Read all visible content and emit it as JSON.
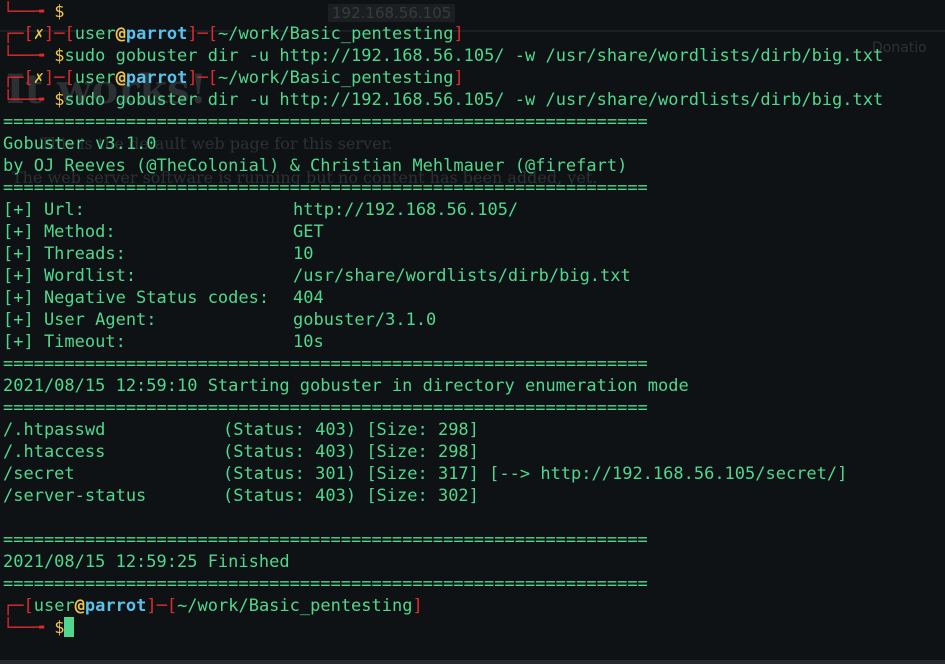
{
  "prompt": {
    "user": "user",
    "at": "@",
    "host": "parrot",
    "path": "~/work/Basic_pentesting",
    "error_mark": "✗",
    "dollar": "$"
  },
  "background_browser": {
    "url": "192.168.56.105",
    "donate": "Donatio",
    "heading": "It works!",
    "line1": "This is the default web page for this server.",
    "line2": "The web server software is running but no content has been added, yet."
  },
  "commands": {
    "first": "sudo gobuster dir -u http://192.168.56.105/ -w /usr/share/wordlists/dirb/big.txt",
    "second": "sudo gobuster dir -u http://192.168.56.105/ -w /usr/share/wordlists/dirb/big.txt"
  },
  "separator": "===============================================================",
  "banner": {
    "title": "Gobuster v3.1.0",
    "authors": "by OJ Reeves (@TheColonial) & Christian Mehlmauer (@firefart)"
  },
  "config": [
    {
      "key": "[+] Url:",
      "value": "http://192.168.56.105/"
    },
    {
      "key": "[+] Method:",
      "value": "GET"
    },
    {
      "key": "[+] Threads:",
      "value": "10"
    },
    {
      "key": "[+] Wordlist:",
      "value": "/usr/share/wordlists/dirb/big.txt"
    },
    {
      "key": "[+] Negative Status codes:",
      "value": "404"
    },
    {
      "key": "[+] User Agent:",
      "value": "gobuster/3.1.0"
    },
    {
      "key": "[+] Timeout:",
      "value": "10s"
    }
  ],
  "start_message": "2021/08/15 12:59:10 Starting gobuster in directory enumeration mode",
  "results": [
    {
      "path": "/.htpasswd",
      "status": "(Status: 403)",
      "size": "[Size: 298]",
      "redirect": ""
    },
    {
      "path": "/.htaccess",
      "status": "(Status: 403)",
      "size": "[Size: 298]",
      "redirect": ""
    },
    {
      "path": "/secret",
      "status": "(Status: 301)",
      "size": "[Size: 317]",
      "redirect": "[--> http://192.168.56.105/secret/]"
    },
    {
      "path": "/server-status",
      "status": "(Status: 403)",
      "size": "[Size: 302]",
      "redirect": ""
    }
  ],
  "finish_message": "2021/08/15 12:59:25 Finished"
}
